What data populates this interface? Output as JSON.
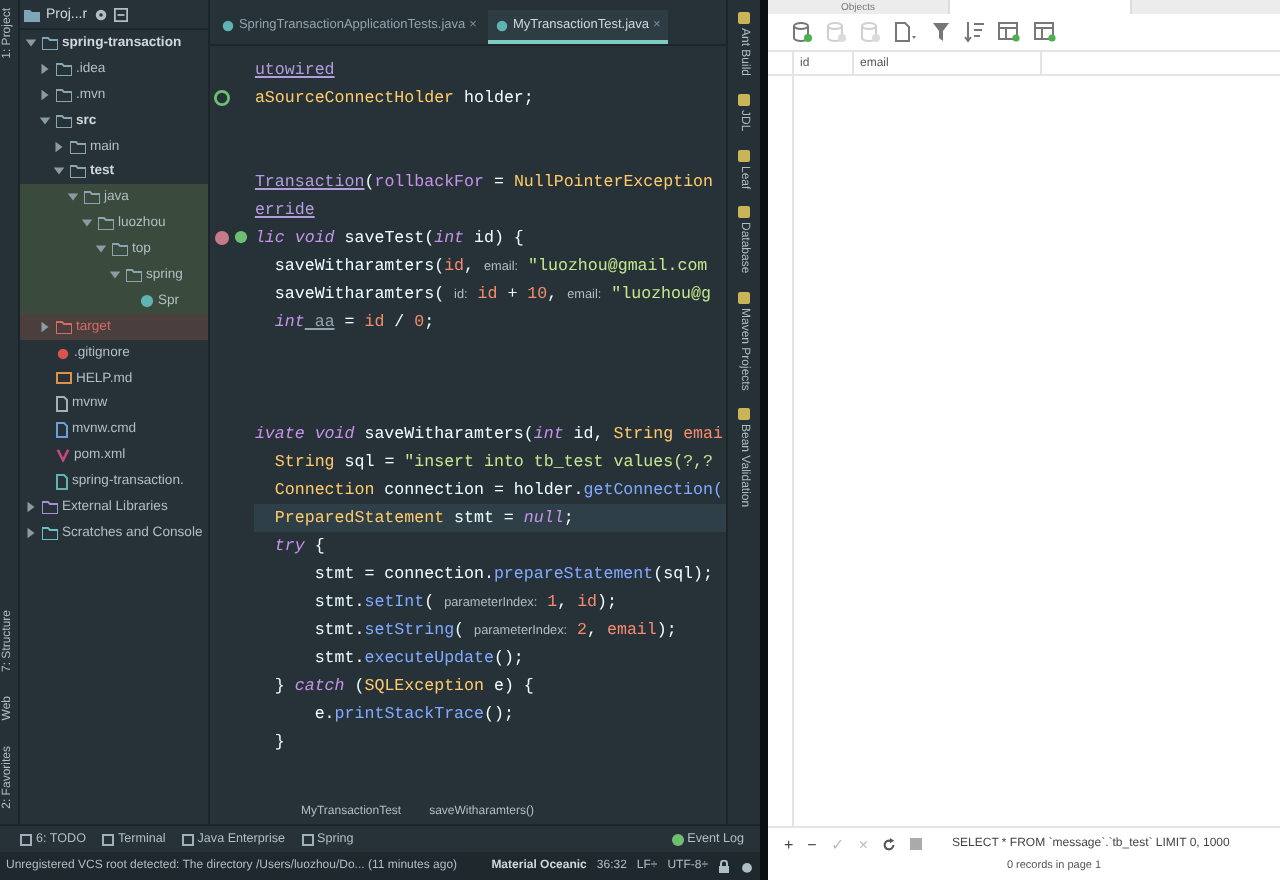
{
  "left_strip": {
    "top": [
      "1: Project"
    ],
    "bottom": [
      "7: Structure",
      "Web",
      "2: Favorites"
    ]
  },
  "project": {
    "title": "Proj...r",
    "tree": [
      {
        "label": "spring-transaction",
        "kind": "module",
        "expanded": true,
        "children": [
          {
            "label": ".idea",
            "kind": "folder",
            "expanded": false
          },
          {
            "label": ".mvn",
            "kind": "folder",
            "expanded": false
          },
          {
            "label": "src",
            "kind": "folder",
            "expanded": true,
            "children": [
              {
                "label": "main",
                "kind": "folder",
                "expanded": false
              },
              {
                "label": "test",
                "kind": "folder",
                "expanded": true,
                "children": [
                  {
                    "label": "java",
                    "kind": "folder",
                    "expanded": true,
                    "in_scope": true,
                    "children": [
                      {
                        "label": "luozhou",
                        "kind": "folder",
                        "expanded": true,
                        "in_scope": true,
                        "children": [
                          {
                            "label": "top",
                            "kind": "folder",
                            "expanded": true,
                            "in_scope": true,
                            "children": [
                              {
                                "label": "spring",
                                "kind": "folder",
                                "expanded": true,
                                "in_scope": true,
                                "children": [
                                  {
                                    "label": "Spr",
                                    "kind": "class",
                                    "in_scope": true
                                  }
                                ]
                              }
                            ]
                          }
                        ]
                      }
                    ]
                  }
                ]
              }
            ]
          },
          {
            "label": "target",
            "kind": "excluded-folder",
            "expanded": false,
            "excluded": true
          },
          {
            "label": ".gitignore",
            "kind": "git"
          },
          {
            "label": "HELP.md",
            "kind": "markdown"
          },
          {
            "label": "mvnw",
            "kind": "script"
          },
          {
            "label": "mvnw.cmd",
            "kind": "cmd"
          },
          {
            "label": "pom.xml",
            "kind": "maven"
          },
          {
            "label": "spring-transaction.",
            "kind": "iml"
          }
        ]
      },
      {
        "label": "External Libraries",
        "kind": "library",
        "expanded": false
      },
      {
        "label": "Scratches and Console",
        "kind": "scratch",
        "expanded": false
      }
    ]
  },
  "editor": {
    "tabs": [
      {
        "label": "SpringTransactionApplicationTests.java",
        "close": "×",
        "selected": false
      },
      {
        "label": "MyTransactionTest.java",
        "close": "×",
        "selected": true
      }
    ],
    "lines": [
      {
        "kind": "code",
        "tokens": [
          {
            "text": "utowired",
            "kind": "annotation"
          }
        ]
      },
      {
        "kind": "code",
        "gutter": [
          {
            "kind": "bean"
          }
        ],
        "tokens": [
          {
            "text": "aSourceConnectHolder",
            "kind": "type"
          },
          {
            "text": " holder;",
            "kind": "plain"
          }
        ]
      },
      {
        "kind": "blank"
      },
      {
        "kind": "blank"
      },
      {
        "kind": "code",
        "tokens": [
          {
            "text": "Transaction",
            "kind": "annotation"
          },
          {
            "text": "(",
            "kind": "plain"
          },
          {
            "text": "rollbackFor",
            "kind": "attr"
          },
          {
            "text": " = ",
            "kind": "plain"
          },
          {
            "text": "NullPointerException",
            "kind": "type"
          }
        ]
      },
      {
        "kind": "code",
        "tokens": [
          {
            "text": "erride",
            "kind": "annotation"
          }
        ]
      },
      {
        "kind": "code",
        "gutter": [
          {
            "kind": "breakpoint"
          },
          {
            "kind": "override"
          }
        ],
        "tokens": [
          {
            "text": "lic void",
            "kind": "keyword"
          },
          {
            "text": " saveTest(",
            "kind": "plain"
          },
          {
            "text": "int",
            "kind": "keyword"
          },
          {
            "text": " id) {",
            "kind": "plain"
          }
        ]
      },
      {
        "kind": "code",
        "tokens": [
          {
            "text": "  saveWitharamters(",
            "kind": "plain"
          },
          {
            "text": "id",
            "kind": "param"
          },
          {
            "text": ", ",
            "kind": "plain"
          },
          {
            "text": "email:",
            "kind": "hint"
          },
          {
            "text": " \"luozhou@gmail.com",
            "kind": "string"
          }
        ]
      },
      {
        "kind": "code",
        "tokens": [
          {
            "text": "  saveWitharamters( ",
            "kind": "plain"
          },
          {
            "text": "id:",
            "kind": "hint"
          },
          {
            "text": " id",
            "kind": "param"
          },
          {
            "text": " + ",
            "kind": "plain"
          },
          {
            "text": "10",
            "kind": "number"
          },
          {
            "text": ", ",
            "kind": "plain"
          },
          {
            "text": "email:",
            "kind": "hint"
          },
          {
            "text": " \"luozhou@g",
            "kind": "string"
          }
        ]
      },
      {
        "kind": "code",
        "tokens": [
          {
            "text": "  int",
            "kind": "keyword"
          },
          {
            "text": " aa",
            "kind": "unused"
          },
          {
            "text": " = ",
            "kind": "plain"
          },
          {
            "text": "id",
            "kind": "param"
          },
          {
            "text": " / ",
            "kind": "plain"
          },
          {
            "text": "0",
            "kind": "number"
          },
          {
            "text": ";",
            "kind": "plain"
          }
        ]
      },
      {
        "kind": "blank"
      },
      {
        "kind": "blank"
      },
      {
        "kind": "blank"
      },
      {
        "kind": "code",
        "tokens": [
          {
            "text": "ivate void",
            "kind": "keyword"
          },
          {
            "text": " saveWitharamters(",
            "kind": "plain"
          },
          {
            "text": "int",
            "kind": "keyword"
          },
          {
            "text": " id, ",
            "kind": "plain"
          },
          {
            "text": "String",
            "kind": "type"
          },
          {
            "text": " emai",
            "kind": "param"
          }
        ]
      },
      {
        "kind": "code",
        "tokens": [
          {
            "text": "  String",
            "kind": "type"
          },
          {
            "text": " sql = ",
            "kind": "plain"
          },
          {
            "text": "\"insert into tb_test values(?,?",
            "kind": "string"
          }
        ]
      },
      {
        "kind": "code",
        "tokens": [
          {
            "text": "  Connection",
            "kind": "type"
          },
          {
            "text": " connection = holder.",
            "kind": "plain"
          },
          {
            "text": "getConnection(",
            "kind": "function"
          }
        ]
      },
      {
        "kind": "code",
        "current": true,
        "tokens": [
          {
            "text": "  PreparedStatement",
            "kind": "type"
          },
          {
            "text": " stmt = ",
            "kind": "plain"
          },
          {
            "text": "null",
            "kind": "keyword"
          },
          {
            "text": ";",
            "kind": "plain"
          }
        ]
      },
      {
        "kind": "code",
        "tokens": [
          {
            "text": "  try",
            "kind": "keyword"
          },
          {
            "text": " {",
            "kind": "plain"
          }
        ]
      },
      {
        "kind": "code",
        "tokens": [
          {
            "text": "      stmt = connection.",
            "kind": "plain"
          },
          {
            "text": "prepareStatement",
            "kind": "function"
          },
          {
            "text": "(sql);",
            "kind": "plain"
          }
        ]
      },
      {
        "kind": "code",
        "tokens": [
          {
            "text": "      stmt.",
            "kind": "plain"
          },
          {
            "text": "setInt",
            "kind": "function"
          },
          {
            "text": "( ",
            "kind": "plain"
          },
          {
            "text": "parameterIndex:",
            "kind": "hint"
          },
          {
            "text": " 1",
            "kind": "number"
          },
          {
            "text": ", ",
            "kind": "plain"
          },
          {
            "text": "id",
            "kind": "param"
          },
          {
            "text": ");",
            "kind": "plain"
          }
        ]
      },
      {
        "kind": "code",
        "tokens": [
          {
            "text": "      stmt.",
            "kind": "plain"
          },
          {
            "text": "setString",
            "kind": "function"
          },
          {
            "text": "( ",
            "kind": "plain"
          },
          {
            "text": "parameterIndex:",
            "kind": "hint"
          },
          {
            "text": " 2",
            "kind": "number"
          },
          {
            "text": ", ",
            "kind": "plain"
          },
          {
            "text": "email",
            "kind": "param"
          },
          {
            "text": ");",
            "kind": "plain"
          }
        ]
      },
      {
        "kind": "code",
        "tokens": [
          {
            "text": "      stmt.",
            "kind": "plain"
          },
          {
            "text": "executeUpdate",
            "kind": "function"
          },
          {
            "text": "();",
            "kind": "plain"
          }
        ]
      },
      {
        "kind": "code",
        "tokens": [
          {
            "text": "  } ",
            "kind": "plain"
          },
          {
            "text": "catch",
            "kind": "keyword"
          },
          {
            "text": " (",
            "kind": "plain"
          },
          {
            "text": "SQLException",
            "kind": "type"
          },
          {
            "text": " e) {",
            "kind": "plain"
          }
        ]
      },
      {
        "kind": "code",
        "tokens": [
          {
            "text": "      e.",
            "kind": "plain"
          },
          {
            "text": "printStackTrace",
            "kind": "function"
          },
          {
            "text": "();",
            "kind": "plain"
          }
        ]
      },
      {
        "kind": "code",
        "tokens": [
          {
            "text": "  }",
            "kind": "plain"
          }
        ]
      }
    ],
    "breadcrumbs": [
      "MyTransactionTest",
      "saveWitharamters()"
    ]
  },
  "right_strip": [
    "Ant Build",
    "JDL",
    "Leaf",
    "Database",
    "Maven Projects",
    "Bean Validation"
  ],
  "tool_windows": {
    "left": [
      "6: TODO",
      "Terminal",
      "Java Enterprise",
      "Spring"
    ],
    "right": [
      "Event Log"
    ]
  },
  "status_bar": {
    "message": "Unregistered VCS root detected: The directory /Users/luozhou/Do... (11 minutes ago)",
    "theme": "Material Oceanic",
    "position": "36:32",
    "line_separator": "LF÷",
    "encoding": "UTF-8÷"
  },
  "db_panel": {
    "tabs": [
      {
        "label": "Objects",
        "selected": false
      },
      {
        "selected": true
      }
    ],
    "toolbar": [
      {
        "kind": "add",
        "disabled": false
      },
      {
        "kind": "edit",
        "disabled": true
      },
      {
        "kind": "remove",
        "disabled": true
      },
      {
        "kind": "export",
        "disabled": false
      },
      {
        "kind": "filter",
        "disabled": false
      },
      {
        "kind": "sort",
        "disabled": false
      },
      {
        "kind": "table",
        "disabled": false
      },
      {
        "kind": "table",
        "disabled": false
      }
    ],
    "columns": [
      "id",
      "email"
    ],
    "actions": [
      {
        "label": "+",
        "disabled": false
      },
      {
        "label": "−",
        "disabled": false
      },
      {
        "label": "✓",
        "disabled": true
      },
      {
        "label": "×",
        "disabled": true
      }
    ],
    "query": "SELECT * FROM `message`.`tb_test` LIMIT 0, 1000",
    "footer": "0 records in page 1"
  }
}
